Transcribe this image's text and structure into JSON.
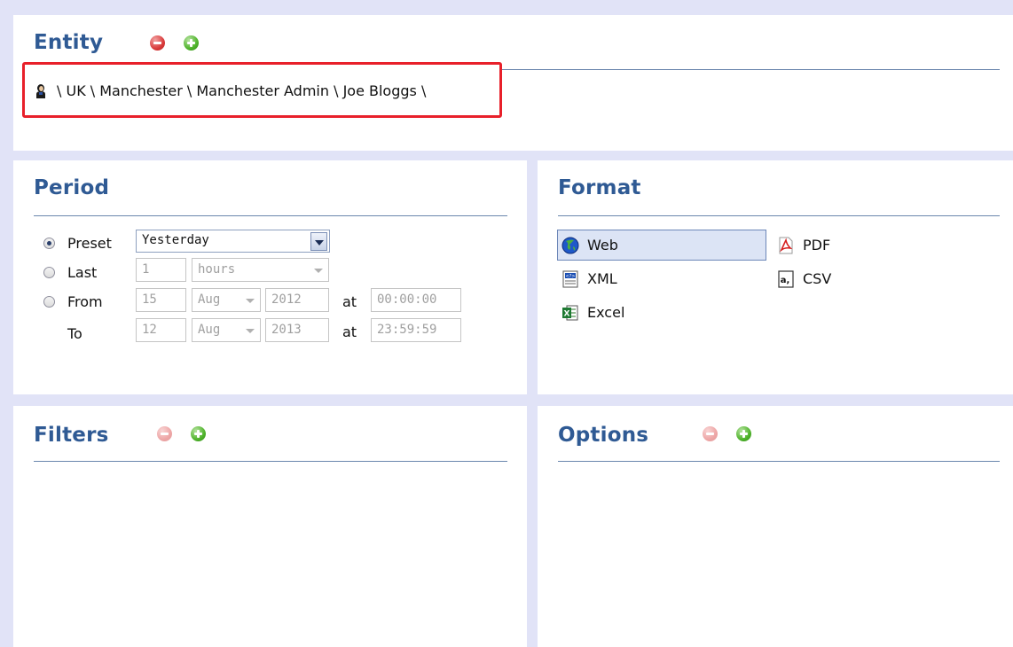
{
  "entity": {
    "title": "Entity",
    "path": "\\ UK \\ Manchester \\ Manchester Admin \\ Joe Bloggs \\"
  },
  "period": {
    "title": "Period",
    "preset_label": "Preset",
    "preset_value": "Yesterday",
    "last_label": "Last",
    "last_value": "1",
    "last_unit": "hours",
    "from_label": "From",
    "from_day": "15",
    "from_month": "Aug",
    "from_year": "2012",
    "from_at": "at",
    "from_time": "00:00:00",
    "to_label": "To",
    "to_day": "12",
    "to_month": "Aug",
    "to_year": "2013",
    "to_at": "at",
    "to_time": "23:59:59",
    "selected": "Preset"
  },
  "format": {
    "title": "Format",
    "options": [
      "Web",
      "PDF",
      "XML",
      "CSV",
      "Excel"
    ],
    "selected": "Web"
  },
  "filters": {
    "title": "Filters"
  },
  "options": {
    "title": "Options"
  },
  "colors": {
    "title": "#2f5a94",
    "background": "#e1e3f7",
    "highlight": "#e8202a",
    "selected_format": "#dce4f5"
  },
  "icons": {
    "remove": "minus-circle-icon",
    "add": "plus-circle-icon",
    "user": "user-icon",
    "web": "globe-icon",
    "pdf": "pdf-icon",
    "xml": "xml-icon",
    "csv": "csv-icon",
    "excel": "excel-icon"
  }
}
